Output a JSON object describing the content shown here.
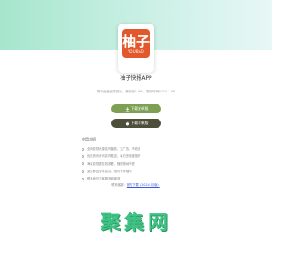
{
  "app": {
    "icon_glyph": "柚子",
    "icon_latin": "YOUBAO",
    "name": "柚子快报APP",
    "meta": "简单全面优质阅读，最新版1.9.6，更新时间2024-1-08"
  },
  "downloads": {
    "android_label": "下载安卓版",
    "ios_label": "下载苹果版"
  },
  "intro": {
    "title": "应用介绍",
    "items": [
      "全网影视资源实时播放，无广告，不收费",
      "优质资讯资讯实时推送，每日多维度推荐",
      "海量影视剧在线观看，随时随地享受",
      "激活即送全年会员，限时专享福利",
      "联系我们与客服咨询渠道"
    ]
  },
  "footer": {
    "prefix": "联系客服：",
    "link_text": "官方下载（20241月版）"
  },
  "watermark": "聚集网",
  "colors": {
    "hero_gradient_start": "#a6e6cc",
    "icon_bg": "#e2582c",
    "android_btn": "#7ea055",
    "ios_btn": "#4e4f3b",
    "link": "#3a5bd9",
    "watermark": "#3fc283"
  }
}
